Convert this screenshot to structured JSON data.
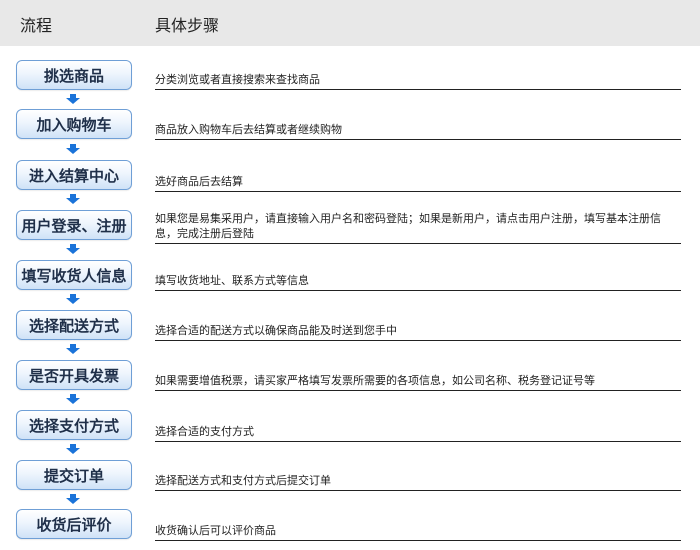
{
  "header": {
    "col1": "流程",
    "col2": "具体步骤"
  },
  "steps": [
    {
      "label": "挑选商品",
      "desc": "分类浏览或者直接搜索来查找商品"
    },
    {
      "label": "加入购物车",
      "desc": "商品放入购物车后去结算或者继续购物"
    },
    {
      "label": "进入结算中心",
      "desc": "选好商品后去结算"
    },
    {
      "label": "用户登录、注册",
      "desc": "如果您是易集采用户，请直接输入用户名和密码登陆；如果是新用户，请点击用户注册，填写基本注册信息，完成注册后登陆"
    },
    {
      "label": "填写收货人信息",
      "desc": "填写收货地址、联系方式等信息"
    },
    {
      "label": "选择配送方式",
      "desc": "选择合适的配送方式以确保商品能及时送到您手中"
    },
    {
      "label": "是否开具发票",
      "desc": "如果需要增值税票，请买家严格填写发票所需要的各项信息，如公司名称、税务登记证号等"
    },
    {
      "label": "选择支付方式",
      "desc": "选择合适的支付方式"
    },
    {
      "label": "提交订单",
      "desc": "选择配送方式和支付方式后提交订单"
    },
    {
      "label": "收货后评价",
      "desc": "收货确认后可以评价商品"
    }
  ],
  "colors": {
    "header_bg": "#e8e8e8",
    "button_border": "#6f9fd6",
    "arrow": "#1a73d9"
  }
}
